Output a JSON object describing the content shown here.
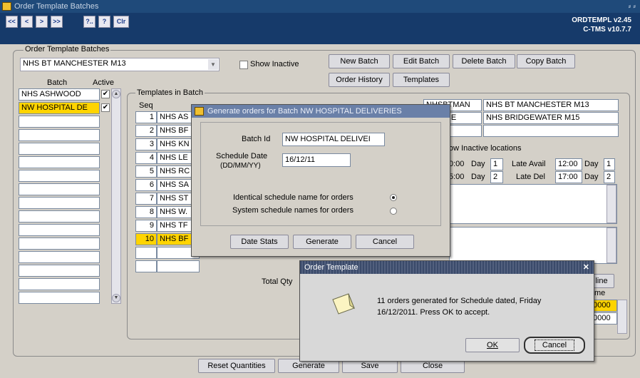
{
  "window": {
    "title": "Order Template Batches",
    "controls": "⸗ ⸗"
  },
  "toolbar": {
    "buttons": [
      "<<",
      "<",
      ">",
      ">>",
      "?..",
      "?",
      "Clr"
    ],
    "version_line1": "ORDTEMPL v2.45",
    "version_line2": "C-TMS v10.7.7"
  },
  "batches_group": {
    "label": "Order Template Batches",
    "batch_select_value": "NHS BT MANCHESTER M13",
    "show_inactive_label": "Show Inactive",
    "col_batch": "Batch",
    "col_active": "Active",
    "rows": [
      {
        "name": "NHS ASHWOOD",
        "active": "✔"
      },
      {
        "name": "NW HOSPITAL DE",
        "active": "✔"
      }
    ]
  },
  "actions": {
    "new_batch": "New Batch",
    "edit_batch": "Edit Batch",
    "delete_batch": "Delete Batch",
    "copy_batch": "Copy Batch",
    "order_history": "Order History",
    "templates": "Templates"
  },
  "templates_group": {
    "label": "Templates in Batch",
    "col_seq": "Seq",
    "rows": [
      {
        "seq": "1",
        "name": "NHS AS"
      },
      {
        "seq": "2",
        "name": "NHS BF"
      },
      {
        "seq": "3",
        "name": "NHS KN"
      },
      {
        "seq": "4",
        "name": "NHS LE"
      },
      {
        "seq": "5",
        "name": "NHS RC"
      },
      {
        "seq": "6",
        "name": "NHS SA"
      },
      {
        "seq": "7",
        "name": "NHS ST"
      },
      {
        "seq": "8",
        "name": "NHS W."
      },
      {
        "seq": "9",
        "name": "NHS TF"
      },
      {
        "seq": "10",
        "name": "NHS BF"
      }
    ],
    "code1": "NHSBTMAN",
    "name1": "NHS BT MANCHESTER M13",
    "code2": "BRIDGE",
    "name2": "NHS BRIDGEWATER M15",
    "show_inactive_locations": "ow Inactive locations",
    "time1": "0:00",
    "day_label": "Day",
    "day1": "1",
    "late_avail_label": "Late Avail",
    "late_avail_time": "12:00",
    "late_avail_day": "1",
    "time2": "5:00",
    "day2": "2",
    "late_del_label": "Late Del",
    "late_del_time": "17:00",
    "late_del_day": "2",
    "total_qty_label": "Total Qty",
    "line_btn": "line",
    "me_label": "me",
    "val1": "00000",
    "val2": "00000"
  },
  "bottom": {
    "reset_quantities": "Reset Quantities",
    "generate": "Generate",
    "save": "Save",
    "close": "Close"
  },
  "gen_dialog": {
    "title": "Generate orders for Batch NW HOSPITAL DELIVERIES",
    "batch_id_label": "Batch Id",
    "batch_id_value": "NW HOSPITAL DELIVEI",
    "schedule_date_label": "Schedule Date",
    "schedule_date_format": "(DD/MM/YY)",
    "schedule_date_value": "16/12/11",
    "identical_label": "Identical schedule name for orders",
    "system_label": "System schedule names for orders",
    "date_stats": "Date Stats",
    "generate": "Generate",
    "cancel": "Cancel"
  },
  "alert": {
    "title": "Order Template",
    "close_glyph": "✕",
    "message_line1": "11 orders generated for Schedule dated, Friday",
    "message_line2": "16/12/2011. Press OK to accept.",
    "ok": "OK",
    "cancel": "Cancel"
  }
}
